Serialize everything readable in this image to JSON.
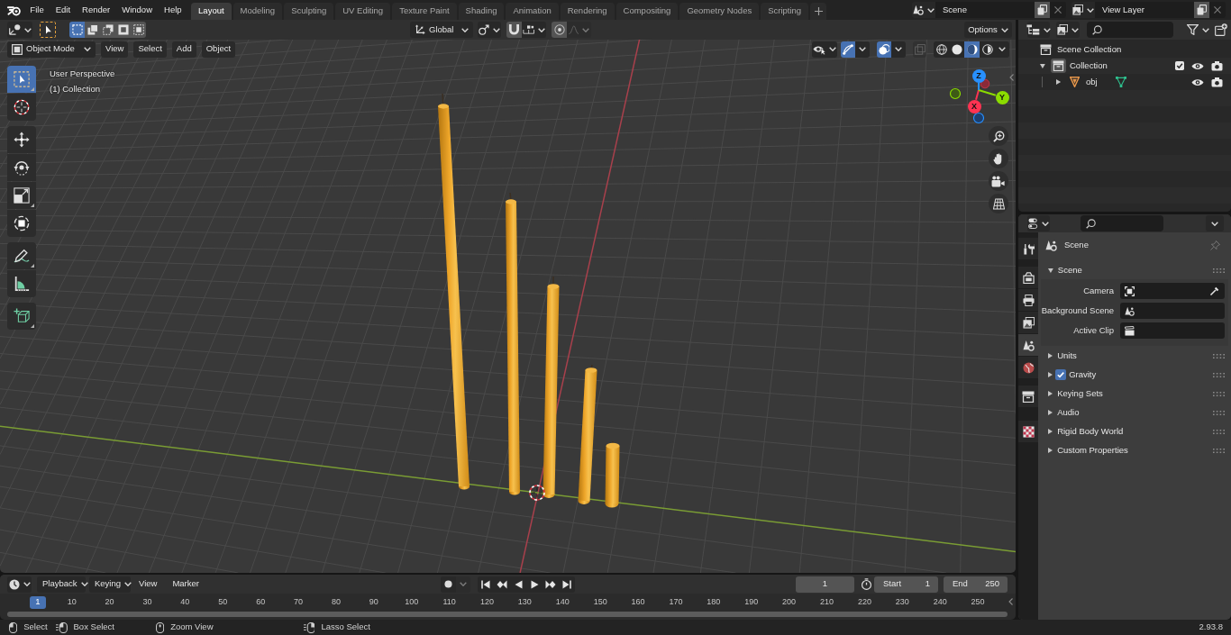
{
  "top_bar": {
    "menus": [
      "File",
      "Edit",
      "Render",
      "Window",
      "Help"
    ],
    "workspaces": [
      {
        "label": "Layout",
        "selected": true
      },
      {
        "label": "Modeling",
        "selected": false
      },
      {
        "label": "Sculpting",
        "selected": false
      },
      {
        "label": "UV Editing",
        "selected": false
      },
      {
        "label": "Texture Paint",
        "selected": false
      },
      {
        "label": "Shading",
        "selected": false
      },
      {
        "label": "Animation",
        "selected": false
      },
      {
        "label": "Rendering",
        "selected": false
      },
      {
        "label": "Compositing",
        "selected": false
      },
      {
        "label": "Geometry Nodes",
        "selected": false
      },
      {
        "label": "Scripting",
        "selected": false
      }
    ],
    "scene": "Scene",
    "view_layer": "View Layer"
  },
  "viewport": {
    "tool_header": {
      "select_modes": [
        {
          "selected": true
        },
        {
          "selected": false
        },
        {
          "selected": false
        },
        {
          "selected": false
        },
        {
          "selected": false
        }
      ],
      "orientation": "Global",
      "snap": {
        "on": false
      },
      "proportional_editing": {
        "on": false
      },
      "options": "Options"
    },
    "header": {
      "mode": "Object Mode",
      "menus": [
        "View",
        "Select",
        "Add",
        "Object"
      ],
      "gizmos": {
        "on": true
      },
      "overlays": {
        "on": true
      },
      "xray": {
        "disabled": true
      },
      "shading": [
        {
          "selected": false
        },
        {
          "selected": false
        },
        {
          "selected": true
        },
        {
          "selected": false
        }
      ]
    },
    "tool_groups": [
      {
        "tools": [
          {
            "selected": true
          },
          {
            "selected": false
          }
        ]
      },
      {
        "tools": [
          {
            "selected": false
          },
          {
            "selected": false
          },
          {
            "selected": false
          },
          {
            "selected": false
          }
        ]
      },
      {
        "tools": [
          {
            "selected": false
          },
          {
            "selected": false
          }
        ]
      },
      {
        "tools": [
          {
            "selected": false
          }
        ]
      }
    ],
    "overlay_text": [
      "User Perspective",
      "(1) Collection"
    ],
    "gizmo_axes": [
      "X",
      "Y",
      "Z"
    ]
  },
  "outliner": {
    "tree": [
      {
        "label": "Scene Collection",
        "kind": "scene_collection",
        "active": false,
        "children": [
          {
            "label": "Collection",
            "kind": "collection",
            "active": true,
            "expanded": true,
            "checked": true,
            "children": [
              {
                "label": "obj",
                "kind": "mesh",
                "active": false,
                "expanded": false
              }
            ]
          }
        ]
      }
    ]
  },
  "properties": {
    "tab_groups": [
      {
        "tabs": [
          {
            "selected": false
          }
        ]
      },
      {
        "tabs": [
          {
            "selected": false
          },
          {
            "selected": false
          },
          {
            "selected": false
          },
          {
            "selected": true
          },
          {
            "selected": false
          }
        ]
      },
      {
        "tabs": [
          {
            "selected": false
          }
        ]
      },
      {
        "tabs": [
          {
            "selected": false
          }
        ]
      }
    ],
    "context": "Scene",
    "panels": [
      {
        "label": "Scene",
        "expanded": true,
        "fields": [
          {
            "label": "Camera",
            "kind": "object"
          },
          {
            "label": "Background Scene",
            "kind": "scene"
          },
          {
            "label": "Active Clip",
            "kind": "clip"
          }
        ]
      },
      {
        "label": "Units",
        "expanded": false
      },
      {
        "label": "Gravity",
        "expanded": false,
        "checked": true
      },
      {
        "label": "Keying Sets",
        "expanded": false
      },
      {
        "label": "Audio",
        "expanded": false
      },
      {
        "label": "Rigid Body World",
        "expanded": false
      },
      {
        "label": "Custom Properties",
        "expanded": false
      }
    ]
  },
  "timeline": {
    "menus": [
      {
        "label": "Playback",
        "kind": "dropdown"
      },
      {
        "label": "Keying",
        "kind": "dropdown"
      },
      {
        "label": "View",
        "kind": "menu"
      },
      {
        "label": "Marker",
        "kind": "menu"
      }
    ],
    "current_frame": "1",
    "start": {
      "label": "Start",
      "value": "1"
    },
    "end": {
      "label": "End",
      "value": "250"
    },
    "playhead": "1",
    "ticks": [
      "10",
      "20",
      "30",
      "40",
      "50",
      "60",
      "70",
      "80",
      "90",
      "100",
      "110",
      "120",
      "130",
      "140",
      "150",
      "160",
      "170",
      "180",
      "190",
      "200",
      "210",
      "220",
      "230",
      "240",
      "250"
    ]
  },
  "status_bar": {
    "hints": [
      "Select",
      "Box Select",
      "Zoom View",
      "Lasso Select"
    ],
    "version": "2.93.8"
  }
}
